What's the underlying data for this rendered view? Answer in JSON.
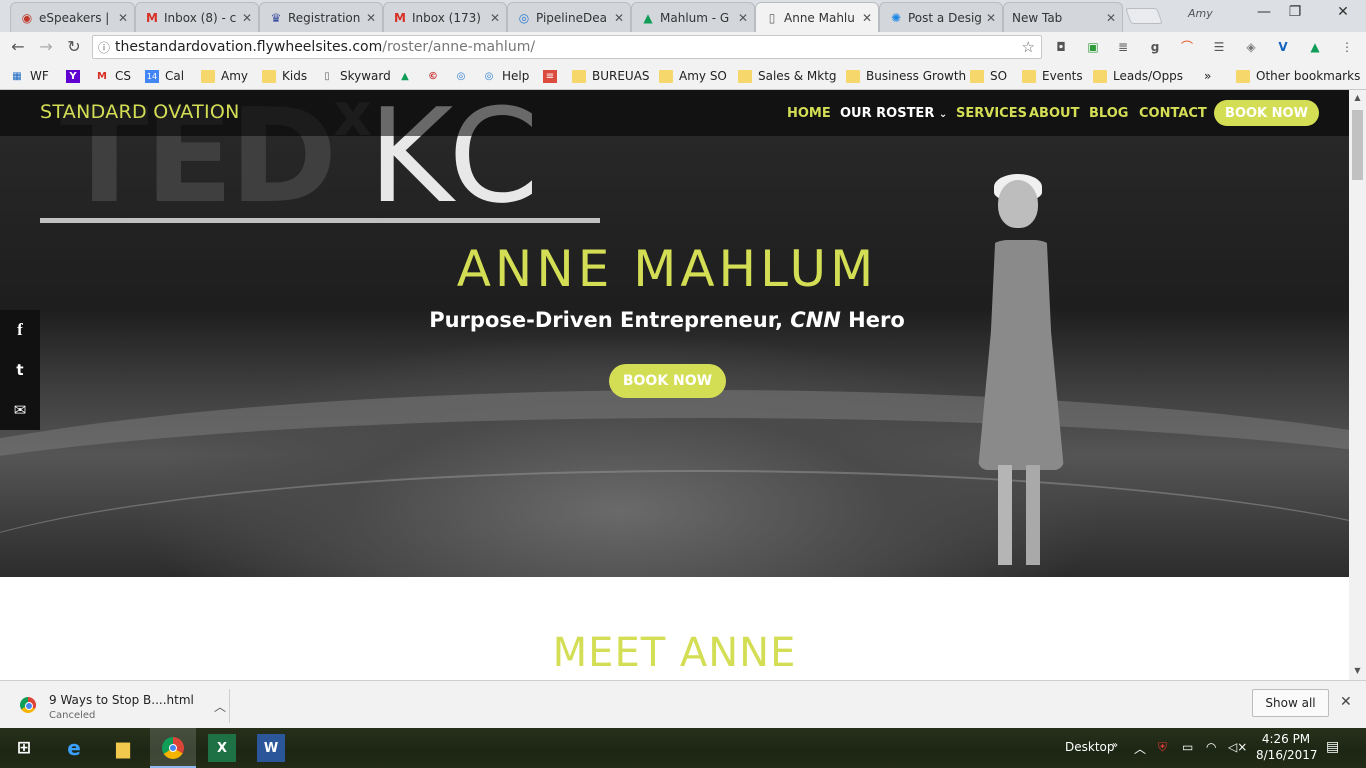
{
  "browser": {
    "tabs": [
      {
        "title": "eSpeakers |",
        "icon": "espeakers-icon"
      },
      {
        "title": "Inbox (8) - c",
        "icon": "gmail-icon"
      },
      {
        "title": "Registration",
        "icon": "crown-icon"
      },
      {
        "title": "Inbox (173)",
        "icon": "gmail-icon"
      },
      {
        "title": "PipelineDea",
        "icon": "pipeline-icon"
      },
      {
        "title": "Mahlum - G",
        "icon": "google-drive-icon"
      },
      {
        "title": "Anne Mahlu",
        "icon": "page-icon"
      },
      {
        "title": "Post a Desig",
        "icon": "sun-icon"
      },
      {
        "title": "New Tab",
        "icon": ""
      }
    ],
    "active_tab": 6,
    "profile_name": "Amy",
    "url_host": "thestandardovation.flywheelsites.com",
    "url_path": "/roster/anne-mahlum/"
  },
  "bookmarks": {
    "items": [
      {
        "label": "WF"
      },
      {
        "label": ""
      },
      {
        "label": "CS"
      },
      {
        "label": "Cal"
      },
      {
        "label": "Amy"
      },
      {
        "label": "Kids"
      },
      {
        "label": "Skyward"
      },
      {
        "label": ""
      },
      {
        "label": ""
      },
      {
        "label": ""
      },
      {
        "label": "Help"
      },
      {
        "label": ""
      },
      {
        "label": "BUREUAS"
      },
      {
        "label": "Amy SO"
      },
      {
        "label": "Sales & Mktg"
      },
      {
        "label": "Business Growth"
      },
      {
        "label": "SO"
      },
      {
        "label": "Events"
      },
      {
        "label": "Leads/Opps"
      }
    ],
    "more": "»",
    "other": "Other bookmarks"
  },
  "site": {
    "logo": "STANDARD OVATION",
    "nav": {
      "home": "HOME",
      "roster": "OUR ROSTER",
      "services": "SERVICES",
      "about": "ABOUT",
      "blog": "BLOG",
      "contact": "CONTACT",
      "book": "BOOK NOW"
    },
    "hero": {
      "bg_text_1": "TED",
      "bg_text_x": "x",
      "bg_text_2": "KC",
      "name": "ANNE MAHLUM",
      "subtitle_1": "Purpose-Driven Entrepreneur, ",
      "subtitle_em": "CNN",
      "subtitle_2": " Hero",
      "book": "BOOK NOW"
    },
    "share": {
      "facebook": "f",
      "twitter": "t",
      "email": "✉"
    },
    "section_title": "MEET ANNE",
    "accent_color": "#d4de55"
  },
  "downloads": {
    "file_name": "9 Ways to Stop B....html",
    "status": "Canceled",
    "show_all": "Show all"
  },
  "taskbar": {
    "desktop_label": "Desktop",
    "time": "4:26 PM",
    "date": "8/16/2017"
  }
}
